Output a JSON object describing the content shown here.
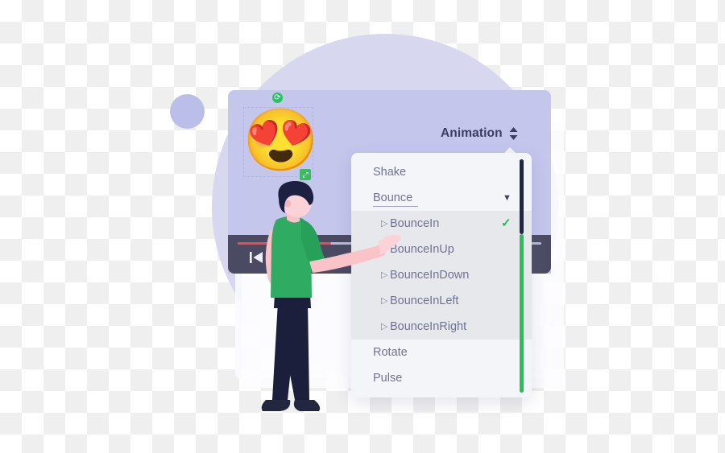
{
  "app": {
    "panel_name": "video-editor-canvas"
  },
  "canvas": {
    "sticker_emoji": "😍",
    "rotate_icon_glyph": "⟳",
    "resize_icon_glyph": "⤢",
    "icons": {
      "rotate": "rotate-icon",
      "resize": "resize-handle-icon"
    }
  },
  "player": {
    "skip_back_icon": "skip-back-icon",
    "fullscreen_icon": "fullscreen-icon",
    "progress_percent": 31,
    "progress_color": "#ef4b4b",
    "bar_color": "#4b4a63"
  },
  "header": {
    "title": "Animation",
    "stepper_icon": "up-down-chevron-icon"
  },
  "dropdown": {
    "items": [
      {
        "label": "Shake",
        "type": "item",
        "expanded": false
      },
      {
        "label": "Bounce",
        "type": "item",
        "expanded": true,
        "caret_glyph": "▼"
      },
      {
        "label": "Rotate",
        "type": "item",
        "expanded": false
      },
      {
        "label": "Pulse",
        "type": "item",
        "expanded": false
      }
    ],
    "bounce_subitems": [
      {
        "label": "BounceIn",
        "selected": true,
        "caret_glyph": "▷",
        "check_glyph": "✓"
      },
      {
        "label": "BounceInUp",
        "selected": false,
        "caret_glyph": "▷",
        "check_glyph": ""
      },
      {
        "label": "BounceInDown",
        "selected": false,
        "caret_glyph": "▷",
        "check_glyph": ""
      },
      {
        "label": "BounceInLeft",
        "selected": false,
        "caret_glyph": "▷",
        "check_glyph": ""
      },
      {
        "label": "BounceInRight",
        "selected": false,
        "caret_glyph": "▷",
        "check_glyph": ""
      }
    ],
    "scrollbar": {
      "thumb_color": "#232546",
      "track_color": "#27c056"
    }
  },
  "colors": {
    "panel_bg": "#c5c6ec",
    "circle_big": "#d7d8f0",
    "circle_small": "#bcbeea",
    "dropdown_bg": "#f4f5f9",
    "group_highlight": "#e7e8ec",
    "text": "#6f7296",
    "title": "#3b3e63",
    "accent_green": "#22bb55",
    "shirt_green": "#2fab62",
    "skin_pink": "#f9c3c8",
    "hair_navy": "#1d2040",
    "pants_navy": "#1b1f3b"
  }
}
